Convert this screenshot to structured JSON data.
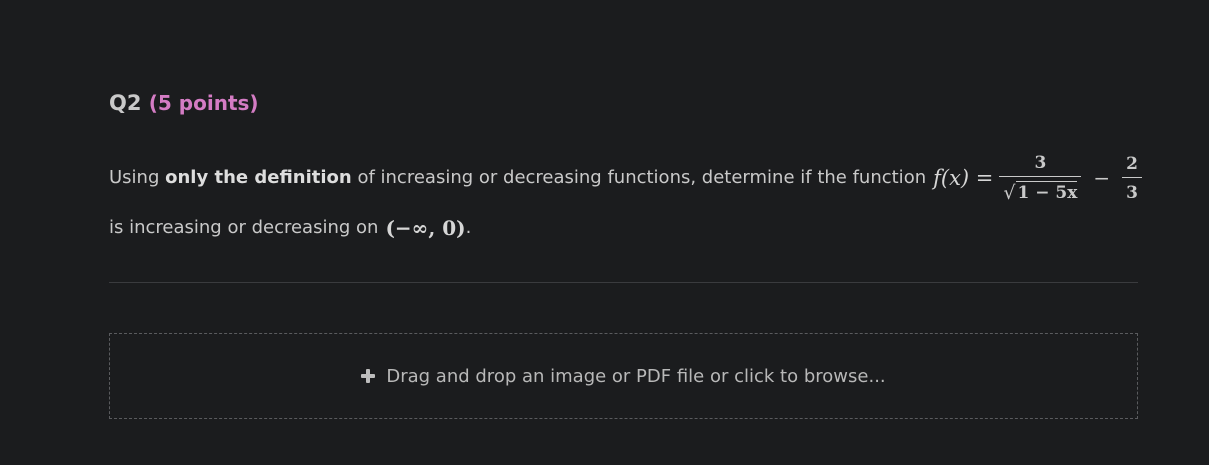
{
  "question": {
    "number": "Q2",
    "points": "(5 points)",
    "text_before_bold": "Using ",
    "bold_text": "only the definition",
    "text_after_bold": " of increasing or decreasing functions, determine if the function",
    "function_lhs": "f(x) =",
    "fraction1": {
      "numerator": "3",
      "denominator_radicand": "1 − 5x"
    },
    "minus": "−",
    "fraction2": {
      "numerator": "2",
      "denominator": "3"
    },
    "line2_text": "is increasing or decreasing on",
    "interval": "(−∞, 0)",
    "period": "."
  },
  "dropzone": {
    "icon": "plus-icon",
    "label": "Drag and drop an image or PDF file or click to browse..."
  }
}
